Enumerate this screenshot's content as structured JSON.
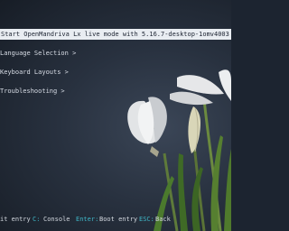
{
  "boot_menu": {
    "entries": [
      {
        "label": "Start OpenMandriva Lx live mode with 5.16.7-desktop-1omv4003",
        "selected": true
      },
      {
        "label": "Language Selection >",
        "selected": false
      },
      {
        "label": "Keyboard Layouts >",
        "selected": false
      },
      {
        "label": "Troubleshooting >",
        "selected": false
      }
    ]
  },
  "footer": {
    "hints": [
      {
        "key": "",
        "action": "it entry"
      },
      {
        "key": "C:",
        "action": "Console"
      },
      {
        "key": "Enter:",
        "action": "Boot entry"
      },
      {
        "key": "ESC:",
        "action": "Back"
      }
    ]
  },
  "colors": {
    "background": "#1c2430",
    "selected_background": "#e9edf2",
    "selected_text": "#1b2230",
    "text": "#d8dde6",
    "key_accent": "#3fb7c8"
  },
  "background_image": "white-crocus-flowers"
}
